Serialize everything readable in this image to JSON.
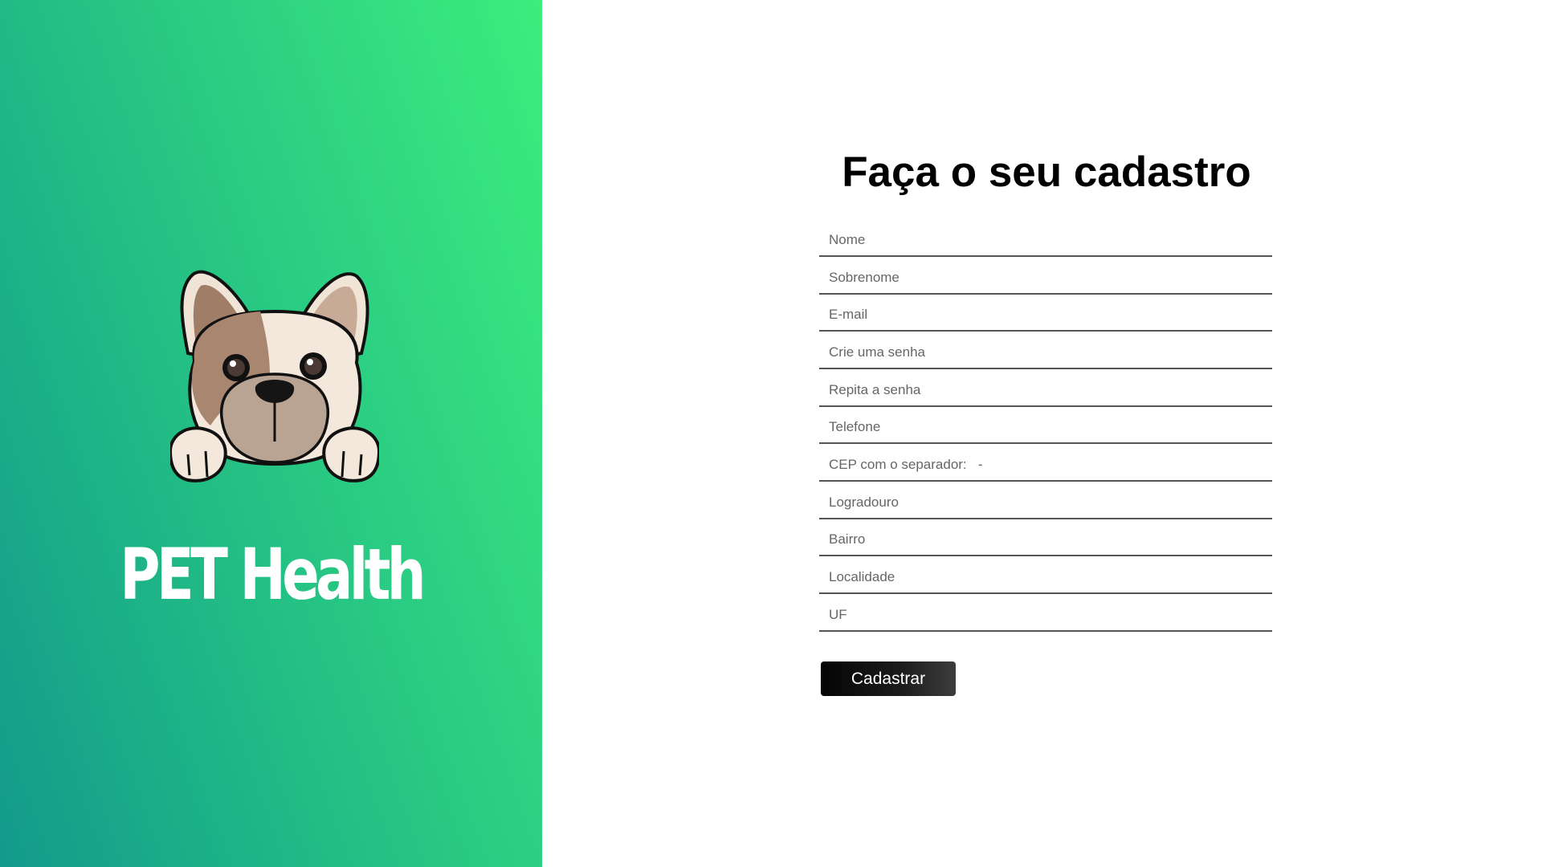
{
  "brand": {
    "name": "PET Health",
    "logo_icon": "french-bulldog-icon",
    "gradient_colors": [
      "#129a8c",
      "#3ded7d"
    ]
  },
  "form": {
    "title": "Faça o seu cadastro",
    "fields": {
      "nome": {
        "placeholder": "Nome",
        "value": ""
      },
      "sobrenome": {
        "placeholder": "Sobrenome",
        "value": ""
      },
      "email": {
        "placeholder": "E-mail",
        "value": ""
      },
      "senha": {
        "placeholder": "Crie uma senha",
        "value": ""
      },
      "repita_senha": {
        "placeholder": "Repita a senha",
        "value": ""
      },
      "telefone": {
        "placeholder": "Telefone",
        "value": ""
      },
      "cep": {
        "placeholder": "CEP com o separador:   -",
        "value": ""
      },
      "logradouro": {
        "placeholder": "Logradouro",
        "value": ""
      },
      "bairro": {
        "placeholder": "Bairro",
        "value": ""
      },
      "localidade": {
        "placeholder": "Localidade",
        "value": ""
      },
      "uf": {
        "placeholder": "UF",
        "value": ""
      }
    },
    "submit_label": "Cadastrar"
  },
  "colors": {
    "button_bg": "#111111",
    "field_border": "#555555"
  }
}
